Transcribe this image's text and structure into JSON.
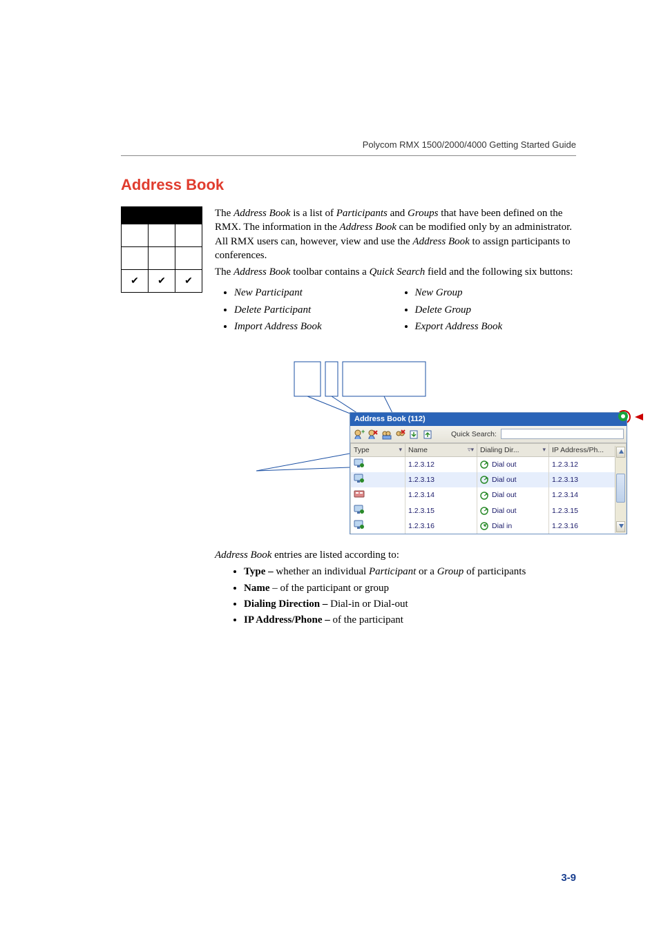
{
  "header": "Polycom RMX 1500/2000/4000 Getting Started Guide",
  "section_title": "Address Book",
  "para1_pre": "The ",
  "para1_ab": "Address Book",
  "para1_mid": " is a list of ",
  "para1_part": "Participants",
  "para1_and": " and ",
  "para1_grp": "Groups",
  "para1_post1": " that have been defined on the RMX. The information in the ",
  "para1_ab2": "Address Book",
  "para1_post2": " can be modified only by an administrator. All RMX users can, however, view and use the ",
  "para1_ab3": "Address Book",
  "para1_post3": " to assign participants to conferences.",
  "para2_pre": "The ",
  "para2_ab": "Address Book",
  "para2_mid": " toolbar contains a ",
  "para2_qs": "Quick Search",
  "para2_post": " field and the following six buttons:",
  "buttons_left": [
    "New Participant",
    "Delete Participant",
    "Import Address Book"
  ],
  "buttons_right": [
    "New Group",
    "Delete Group",
    "Export Address Book"
  ],
  "ab_title": "Address Book (112)",
  "qs_label": "Quick Search:",
  "columns": {
    "c1": "Type",
    "c2": "Name",
    "c3": "Dialing Dir...",
    "c4": "IP Address/Ph..."
  },
  "rows": [
    {
      "type": "ip",
      "name": "1.2.3.12",
      "dir": "Dial out",
      "ip": "1.2.3.12"
    },
    {
      "type": "ip",
      "name": "1.2.3.13",
      "dir": "Dial out",
      "ip": "1.2.3.13"
    },
    {
      "type": "isdn",
      "name": "1.2.3.14",
      "dir": "Dial out",
      "ip": "1.2.3.14"
    },
    {
      "type": "ip",
      "name": "1.2.3.15",
      "dir": "Dial out",
      "ip": "1.2.3.15"
    },
    {
      "type": "ip",
      "name": "1.2.3.16",
      "dir": "Dial in",
      "ip": "1.2.3.16"
    }
  ],
  "entries_intro_em": "Address Book",
  "entries_intro_rest": " entries are listed according to:",
  "entries": {
    "type_l": "Type – ",
    "type_t1": "whether an individual ",
    "type_em1": "Participant",
    "type_t2": " or a ",
    "type_em2": "Group",
    "type_t3": " of participants",
    "name_l": "Name",
    "name_t": " – of the participant or group",
    "dd_l": "Dialing Direction – ",
    "dd_t": "Dial-in or Dial-out",
    "ip_l": "IP Address/Phone – ",
    "ip_t": "of the participant"
  },
  "page_num": "3-9"
}
